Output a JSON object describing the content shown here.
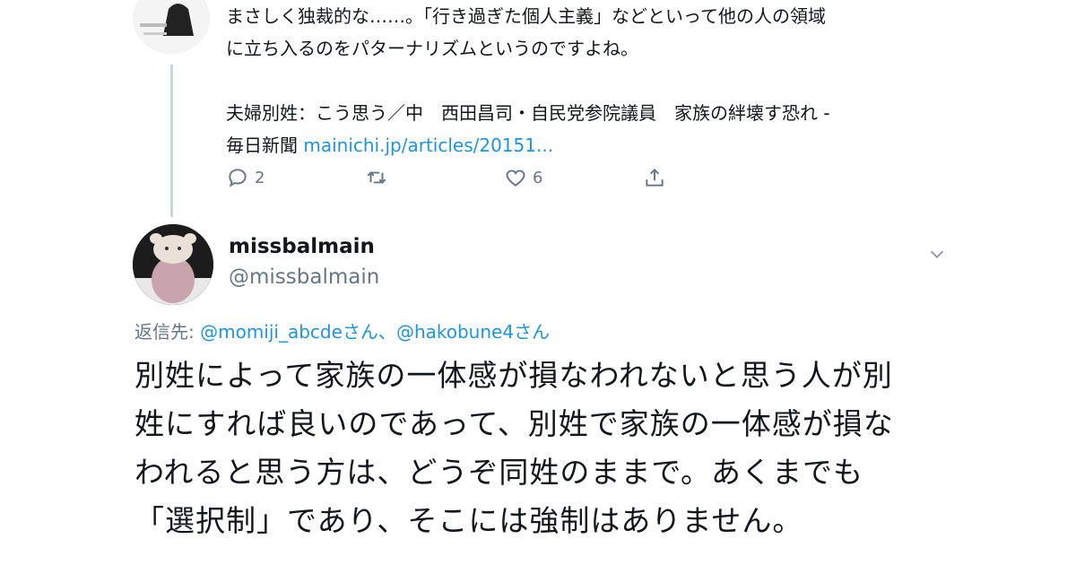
{
  "top_tweet": {
    "text_line1": "まさしく独裁的な……。「行き過ぎた個人主義」などといって他の人の領域",
    "text_line2": "に立ち入るのをパターナリズムというのですよね。",
    "quote_line1": "夫婦別姓：こう思う／中　西田昌司・自民党参院議員　家族の絆壊す恐れ -",
    "quote_line2_prefix": "毎日新聞 ",
    "quote_link": "mainichi.jp/articles/20151...",
    "reply_count": "2",
    "like_count": "6"
  },
  "main_tweet": {
    "display_name": "missbalmain",
    "handle": "@missbalmain",
    "reply_to_prefix": "返信先: ",
    "reply_to_mention1": "@momiji_abcde",
    "reply_to_suffix1": "さん、",
    "reply_to_mention2": "@hakobune4",
    "reply_to_suffix2": "さん",
    "text_line1": "別姓によって家族の一体感が損なわれないと思う人が別",
    "text_line2": "姓にすれば良いのであって、別姓で家族の一体感が損な",
    "text_line3": "われると思う方は、どうぞ同姓のままで。あくまでも",
    "text_line4": "「選択制」であり、そこには強制はありません。"
  },
  "icons": {
    "reply": "reply-icon",
    "retweet": "retweet-icon",
    "like": "heart-icon",
    "share": "share-icon",
    "more": "chevron-down-icon"
  },
  "colors": {
    "link": "#1b95e0",
    "muted": "#657786",
    "text": "#14171a",
    "thread_line": "#ccd6dd"
  }
}
